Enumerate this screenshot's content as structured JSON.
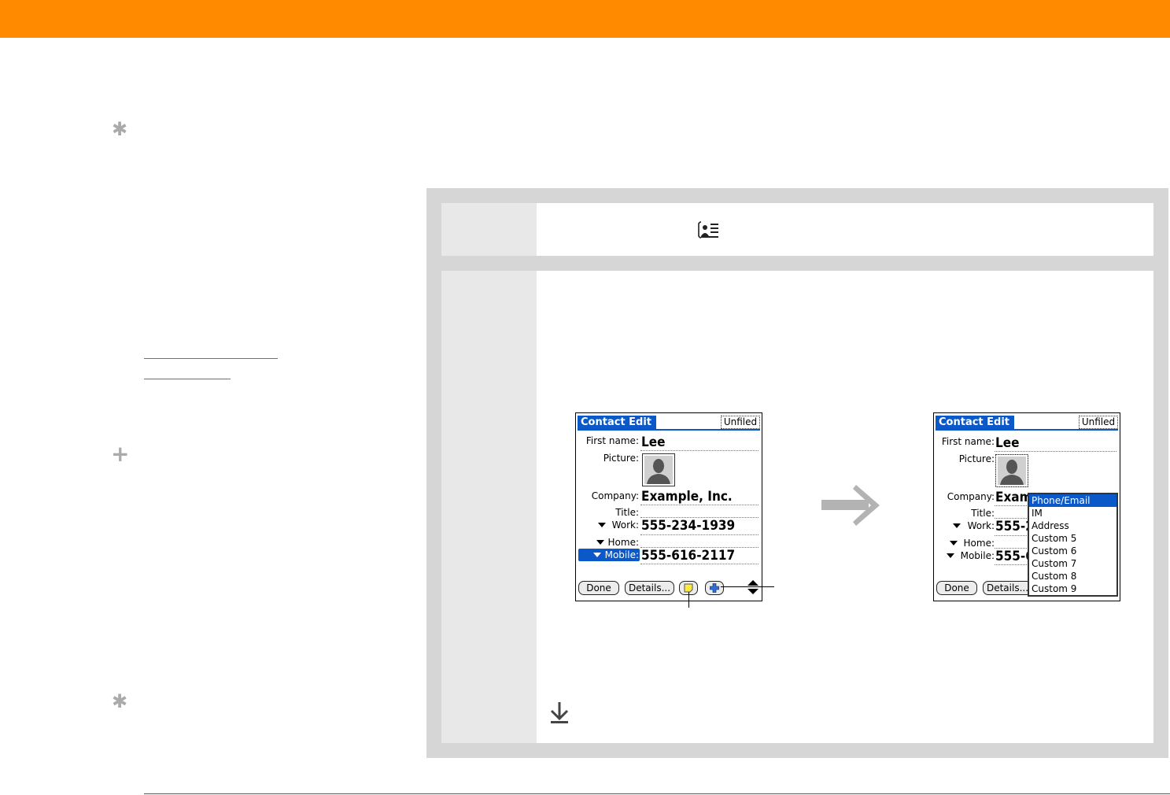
{
  "header": {
    "color": "#ff8a00"
  },
  "sidebar": {
    "glyphs": [
      "✱",
      "+",
      "✱"
    ],
    "link_color": "#2aa02a"
  },
  "screen_left": {
    "title": "Contact Edit",
    "category": "Unfiled",
    "fields": {
      "first_name_label": "First name:",
      "first_name_value": "Lee",
      "picture_label": "Picture:",
      "company_label": "Company:",
      "company_value": "Example, Inc.",
      "title_label": "Title:",
      "work_label": "Work:",
      "work_value": "555-234-1939",
      "home_label": "Home:",
      "mobile_label": "Mobile:",
      "mobile_value": "555-616-2117"
    },
    "buttons": {
      "done": "Done",
      "details": "Details..."
    }
  },
  "screen_right": {
    "title": "Contact Edit",
    "category": "Unfiled",
    "fields": {
      "first_name_label": "First name:",
      "first_name_value": "Lee",
      "picture_label": "Picture:",
      "company_label": "Company:",
      "company_value": "Exam",
      "title_label": "Title:",
      "work_label": "Work:",
      "work_value": "555-2",
      "home_label": "Home:",
      "mobile_label": "Mobile:",
      "mobile_value": "555-6"
    },
    "buttons": {
      "done": "Done",
      "details": "Details..."
    },
    "menu_items": [
      "Phone/Email",
      "IM",
      "Address",
      "Custom 5",
      "Custom 6",
      "Custom 7",
      "Custom 8",
      "Custom 9"
    ]
  },
  "colors": {
    "palm_blue": "#0b59c8",
    "panel_gray": "#d6d6d6",
    "arrow_gray": "#b3b3b3"
  }
}
